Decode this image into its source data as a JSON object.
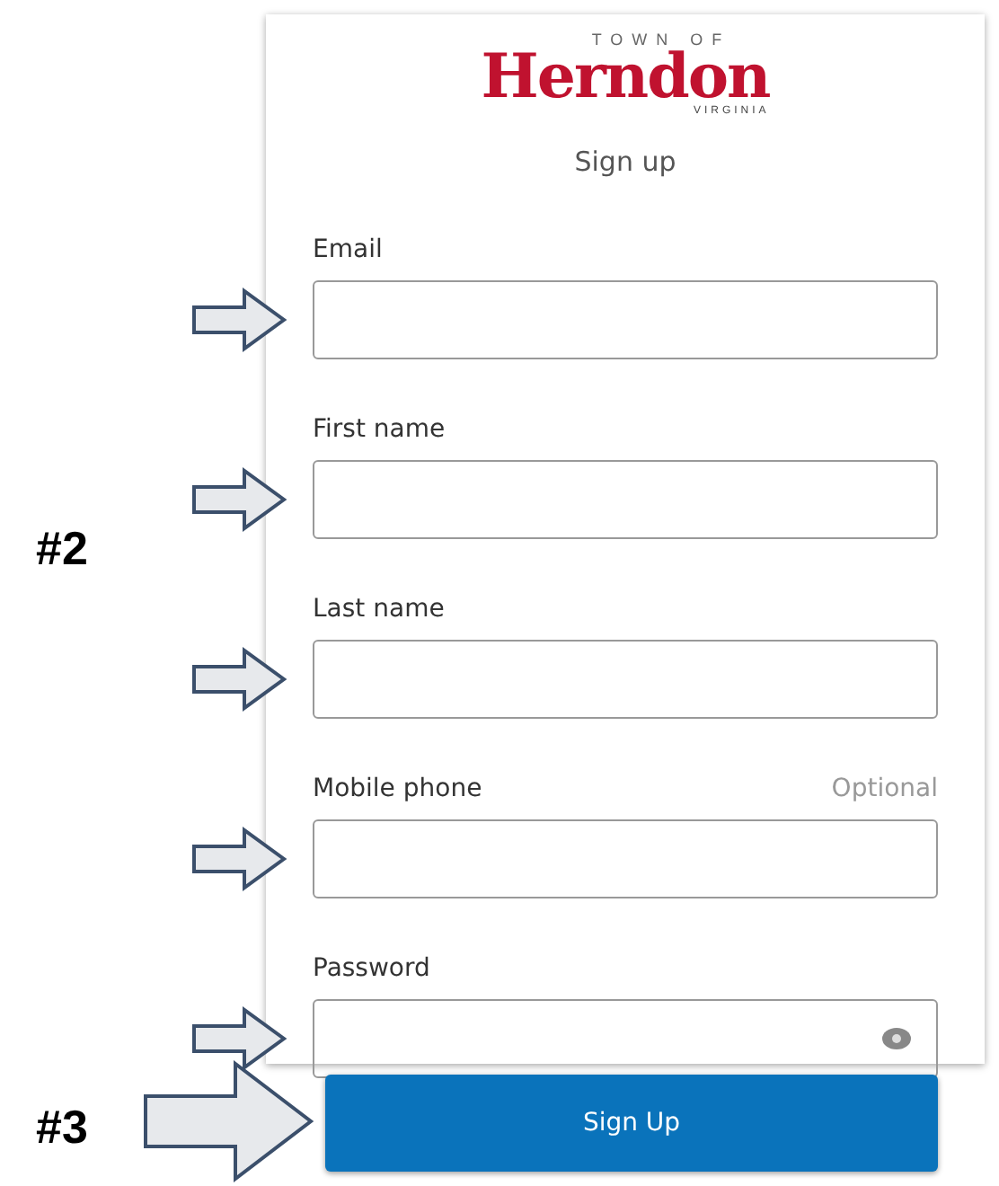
{
  "logo": {
    "top_line": "TOWN OF",
    "name": "Herndon",
    "bottom_line": "VIRGINIA"
  },
  "title": "Sign up",
  "fields": [
    {
      "kind": "text",
      "label": "Email",
      "arrow": true
    },
    {
      "kind": "text",
      "label": "First name",
      "arrow": true
    },
    {
      "kind": "text",
      "label": "Last name",
      "arrow": true
    },
    {
      "kind": "text",
      "label": "Mobile phone",
      "hint": "Optional",
      "arrow": true
    },
    {
      "kind": "password",
      "label": "Password",
      "arrow": true
    }
  ],
  "button": {
    "label": "Sign Up",
    "arrow": true
  },
  "annotations": [
    "#2",
    "#3"
  ]
}
